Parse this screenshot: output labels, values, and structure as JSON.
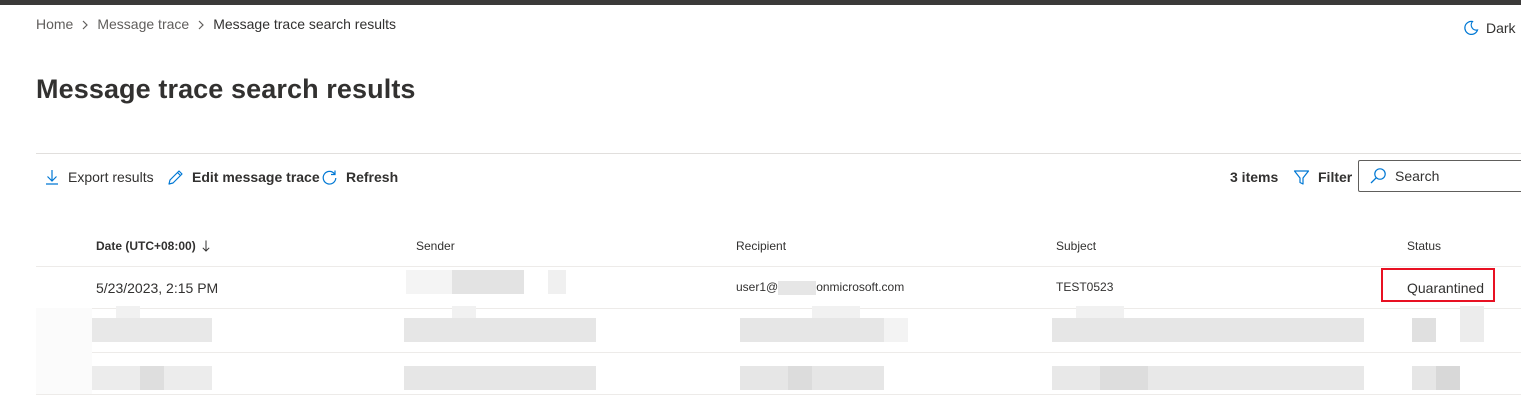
{
  "breadcrumb": {
    "items": [
      "Home",
      "Message trace",
      "Message trace search results"
    ]
  },
  "theme_toggle": {
    "label": "Dark",
    "icon": "moon-icon"
  },
  "page": {
    "title": "Message trace search results"
  },
  "toolbar": {
    "export_label": "Export results",
    "edit_label": "Edit message trace",
    "refresh_label": "Refresh",
    "item_count": "3 items",
    "filter_label": "Filter",
    "search_placeholder": "Search"
  },
  "table": {
    "columns": [
      "Date (UTC+08:00)",
      "Sender",
      "Recipient",
      "Subject",
      "Status"
    ],
    "sort": {
      "column": "Date (UTC+08:00)",
      "direction": "descending"
    },
    "rows": [
      {
        "date": "5/23/2023, 2:15 PM",
        "sender": "",
        "recipient_prefix": "user1@",
        "recipient_suffix": "onmicrosoft.com",
        "subject": "TEST0523",
        "status": "Quarantined"
      }
    ],
    "redacted_rows": 2
  },
  "colors": {
    "accent": "#0078d4",
    "text": "#323130",
    "highlight": "#e81123",
    "topbar": "#3b3a39"
  }
}
